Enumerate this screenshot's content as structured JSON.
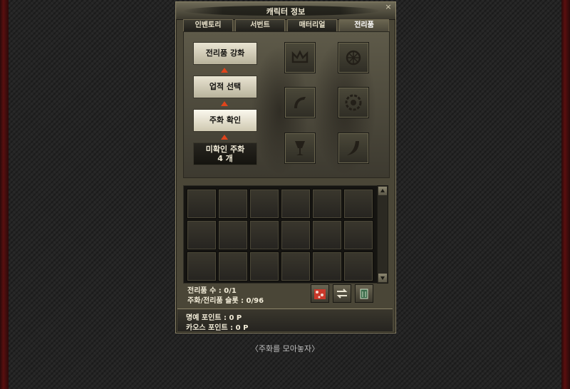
{
  "window": {
    "title": "캐릭터 정보",
    "close_glyph": "×"
  },
  "tabs": [
    {
      "label": "인벤토리",
      "active": false
    },
    {
      "label": "서번트",
      "active": false
    },
    {
      "label": "매터리얼",
      "active": false
    },
    {
      "label": "전리품",
      "active": true
    }
  ],
  "loot_steps": [
    {
      "label": "전리품 강화"
    },
    {
      "label": "업적 선택"
    },
    {
      "label": "주화 확인"
    },
    {
      "label": "미확인 주화",
      "count": "4 개"
    }
  ],
  "equip_slots": [
    {
      "icon": "crown-icon"
    },
    {
      "icon": "flower-emblem-icon"
    },
    {
      "icon": "horn-icon"
    },
    {
      "icon": "gear-emblem-icon"
    },
    {
      "icon": "goblet-icon"
    },
    {
      "icon": "tusk-icon"
    }
  ],
  "stats": {
    "loot_count": "전리품 수 : 0/1",
    "coin_slots": "주화/전리품 슬롯 : 0/96"
  },
  "footer": {
    "honor_points": "명예 포인트 : 0 P",
    "chaos_points": "카오스 포인트 : 0 P"
  },
  "caption": "〈주화를 모아놓자〉",
  "colors": {
    "accent_arrow": "#e0441c",
    "frame_red": "#5a0f0f",
    "window": "#4a4637"
  }
}
